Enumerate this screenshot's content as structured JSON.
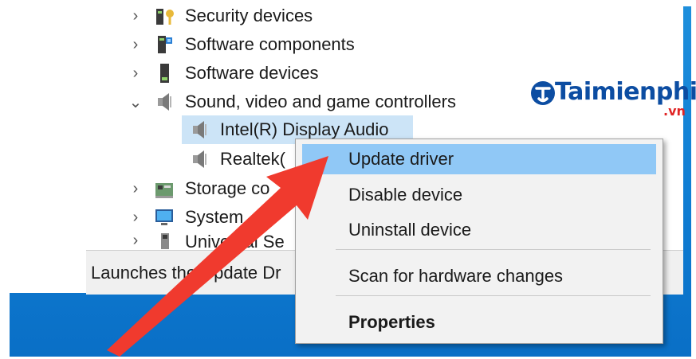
{
  "device_tree": {
    "categories": [
      {
        "label": "Security devices",
        "icon": "security-devices-icon",
        "expanded": false
      },
      {
        "label": "Software components",
        "icon": "software-components-icon",
        "expanded": false
      },
      {
        "label": "Software devices",
        "icon": "software-devices-icon",
        "expanded": false
      },
      {
        "label": "Sound, video and game controllers",
        "icon": "speaker-icon",
        "expanded": true
      },
      {
        "label": "Storage co",
        "icon": "storage-controller-icon",
        "expanded": false
      },
      {
        "label": "System",
        "icon": "system-devices-icon",
        "expanded": false
      },
      {
        "label": "Universal Se",
        "icon": "usb-icon",
        "expanded": false
      }
    ],
    "children": [
      {
        "label": "Intel(R) Display Audio",
        "icon": "speaker-icon",
        "selected": true
      },
      {
        "label": "Realtek(",
        "icon": "speaker-icon",
        "selected": false
      }
    ]
  },
  "status_bar": {
    "text": "Launches the Update Dr"
  },
  "context_menu": {
    "items": [
      {
        "label": "Update driver",
        "highlighted": true,
        "bold": false
      },
      {
        "label": "Disable device",
        "highlighted": false,
        "bold": false
      },
      {
        "label": "Uninstall device",
        "highlighted": false,
        "bold": false
      },
      {
        "label": "Scan for hardware changes",
        "highlighted": false,
        "bold": false
      },
      {
        "label": "Properties",
        "highlighted": false,
        "bold": true
      }
    ]
  },
  "watermark": {
    "brand": "Taimienphi",
    "suffix": ".vn"
  },
  "colors": {
    "desktop_blue": "#0f7dd3",
    "menu_highlight": "#90c8f6",
    "selection": "#cce4f7",
    "arrow_red": "#f03a2e"
  }
}
